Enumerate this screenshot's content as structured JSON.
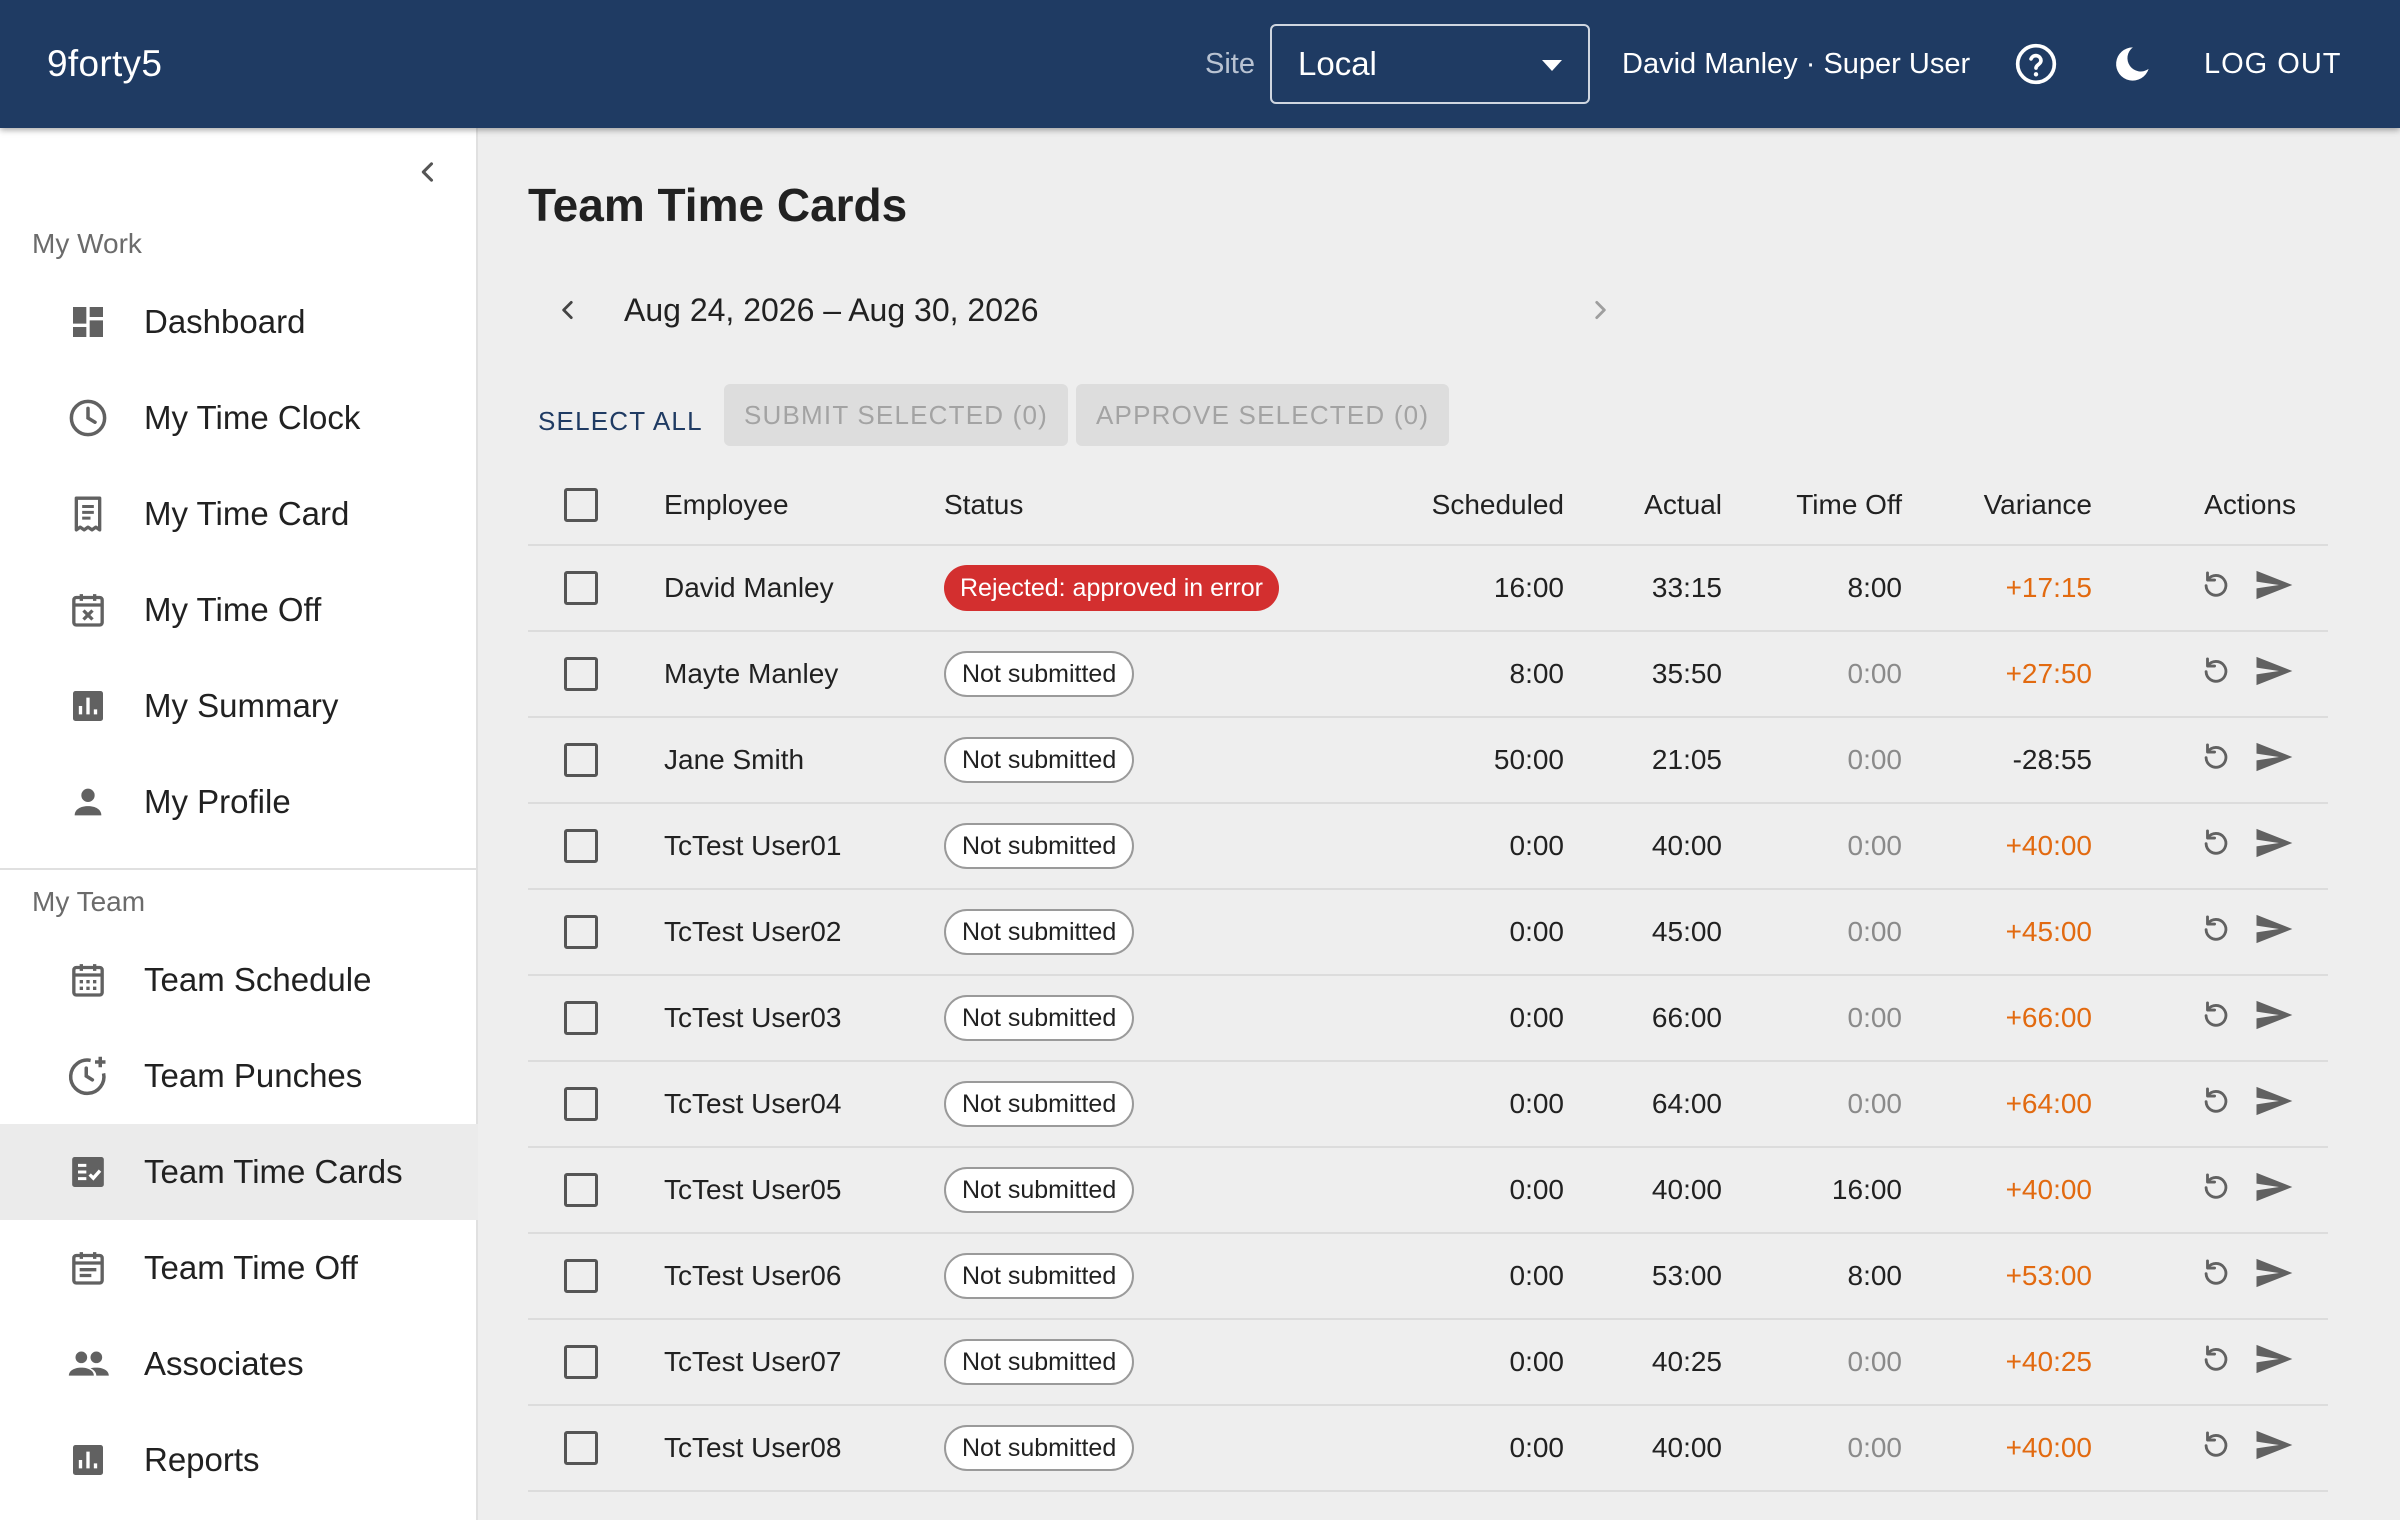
{
  "app": {
    "brand": "9forty5"
  },
  "header": {
    "site_label": "Site",
    "site_value": "Local",
    "user": "David Manley · Super User",
    "logout": "LOG OUT"
  },
  "sidebar": {
    "my_work_title": "My Work",
    "my_work": [
      {
        "label": "Dashboard",
        "icon": "dashboard-icon"
      },
      {
        "label": "My Time Clock",
        "icon": "clock-icon"
      },
      {
        "label": "My Time Card",
        "icon": "receipt-icon"
      },
      {
        "label": "My Time Off",
        "icon": "calendar-x-icon"
      },
      {
        "label": "My Summary",
        "icon": "bar-chart-icon"
      },
      {
        "label": "My Profile",
        "icon": "person-icon"
      }
    ],
    "my_team_title": "My Team",
    "my_team": [
      {
        "label": "Team Schedule",
        "icon": "calendar-grid-icon"
      },
      {
        "label": "Team Punches",
        "icon": "clock-plus-icon"
      },
      {
        "label": "Team Time Cards",
        "icon": "checklist-icon",
        "active": true
      },
      {
        "label": "Team Time Off",
        "icon": "calendar-note-icon"
      },
      {
        "label": "Associates",
        "icon": "people-icon"
      },
      {
        "label": "Reports",
        "icon": "bar-chart-icon"
      }
    ]
  },
  "main": {
    "title": "Team Time Cards",
    "week_range": "Aug 24, 2026 – Aug 30, 2026",
    "select_all": "SELECT ALL",
    "submit_selected": "SUBMIT SELECTED (0)",
    "approve_selected": "APPROVE SELECTED (0)"
  },
  "table": {
    "headers": {
      "employee": "Employee",
      "status": "Status",
      "scheduled": "Scheduled",
      "actual": "Actual",
      "time_off": "Time Off",
      "variance": "Variance",
      "actions": "Actions"
    },
    "rows": [
      {
        "employee": "David Manley",
        "status": "Rejected: approved in error",
        "status_type": "error",
        "scheduled": "16:00",
        "actual": "33:15",
        "time_off": "8:00",
        "variance": "+17:15"
      },
      {
        "employee": "Mayte Manley",
        "status": "Not submitted",
        "status_type": "outline",
        "scheduled": "8:00",
        "actual": "35:50",
        "time_off": "0:00",
        "variance": "+27:50"
      },
      {
        "employee": "Jane Smith",
        "status": "Not submitted",
        "status_type": "outline",
        "scheduled": "50:00",
        "actual": "21:05",
        "time_off": "0:00",
        "variance": "-28:55"
      },
      {
        "employee": "TcTest User01",
        "status": "Not submitted",
        "status_type": "outline",
        "scheduled": "0:00",
        "actual": "40:00",
        "time_off": "0:00",
        "variance": "+40:00"
      },
      {
        "employee": "TcTest User02",
        "status": "Not submitted",
        "status_type": "outline",
        "scheduled": "0:00",
        "actual": "45:00",
        "time_off": "0:00",
        "variance": "+45:00"
      },
      {
        "employee": "TcTest User03",
        "status": "Not submitted",
        "status_type": "outline",
        "scheduled": "0:00",
        "actual": "66:00",
        "time_off": "0:00",
        "variance": "+66:00"
      },
      {
        "employee": "TcTest User04",
        "status": "Not submitted",
        "status_type": "outline",
        "scheduled": "0:00",
        "actual": "64:00",
        "time_off": "0:00",
        "variance": "+64:00"
      },
      {
        "employee": "TcTest User05",
        "status": "Not submitted",
        "status_type": "outline",
        "scheduled": "0:00",
        "actual": "40:00",
        "time_off": "16:00",
        "variance": "+40:00"
      },
      {
        "employee": "TcTest User06",
        "status": "Not submitted",
        "status_type": "outline",
        "scheduled": "0:00",
        "actual": "53:00",
        "time_off": "8:00",
        "variance": "+53:00"
      },
      {
        "employee": "TcTest User07",
        "status": "Not submitted",
        "status_type": "outline",
        "scheduled": "0:00",
        "actual": "40:25",
        "time_off": "0:00",
        "variance": "+40:25"
      },
      {
        "employee": "TcTest User08",
        "status": "Not submitted",
        "status_type": "outline",
        "scheduled": "0:00",
        "actual": "40:00",
        "time_off": "0:00",
        "variance": "+40:00"
      }
    ]
  },
  "colors": {
    "appbar": "#1f3b63",
    "error_chip": "#d32f2f",
    "positive_variance": "#e26a10"
  }
}
